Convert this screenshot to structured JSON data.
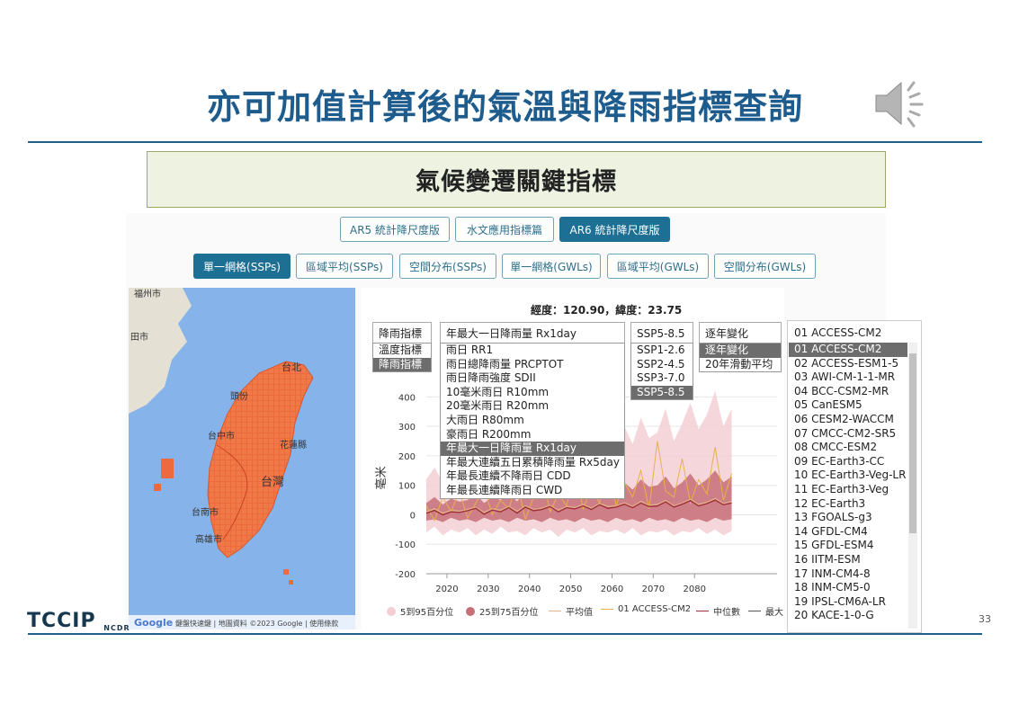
{
  "slide": {
    "title": "亦可加值計算後的氣溫與降雨指標查詢",
    "subtitle": "氣候變遷關鍵指標",
    "page_number": "33",
    "logo_text": "TCCIP",
    "logo_sub": "NCDR"
  },
  "version_tabs": [
    {
      "label": "AR5 統計降尺度版",
      "active": false
    },
    {
      "label": "水文應用指標篇",
      "active": false
    },
    {
      "label": "AR6 統計降尺度版",
      "active": true
    }
  ],
  "mode_tabs": [
    {
      "label": "單一網格(SSPs)",
      "active": true
    },
    {
      "label": "區域平均(SSPs)",
      "active": false
    },
    {
      "label": "空間分布(SSPs)",
      "active": false
    },
    {
      "label": "單一網格(GWLs)",
      "active": false
    },
    {
      "label": "區域平均(GWLs)",
      "active": false
    },
    {
      "label": "空間分布(GWLs)",
      "active": false
    }
  ],
  "map": {
    "labels": [
      "福州市",
      "田市",
      "台北",
      "頭份",
      "台中市",
      "花蓮縣",
      "台灣",
      "台南市",
      "高雄市"
    ],
    "attribution": "鍵盤快速鍵 | 地圖資料 ©2023 Google | 使用條款",
    "google": "Google"
  },
  "coords": "經度：120.90，緯度：23.75",
  "selectors": {
    "category": {
      "value": "降雨指標",
      "options": [
        {
          "label": "溫度指標",
          "selected": false
        },
        {
          "label": "降雨指標",
          "selected": true
        }
      ]
    },
    "index": {
      "value": "年最大一日降雨量 Rx1day",
      "options": [
        {
          "label": "雨日 RR1",
          "selected": false
        },
        {
          "label": "雨日總降雨量 PRCPTOT",
          "selected": false
        },
        {
          "label": "雨日降雨強度 SDII",
          "selected": false
        },
        {
          "label": "10毫米雨日 R10mm",
          "selected": false
        },
        {
          "label": "20毫米雨日 R20mm",
          "selected": false
        },
        {
          "label": "大雨日 R80mm",
          "selected": false
        },
        {
          "label": "豪雨日 R200mm",
          "selected": false
        },
        {
          "label": "年最大一日降雨量 Rx1day",
          "selected": true
        },
        {
          "label": "年最大連續五日累積降雨量 Rx5day",
          "selected": false
        },
        {
          "label": "年最長連續不降雨日 CDD",
          "selected": false
        },
        {
          "label": "年最長連續降雨日 CWD",
          "selected": false
        }
      ]
    },
    "scenario": {
      "value": "SSP5-8.5",
      "options": [
        {
          "label": "SSP1-2.6",
          "selected": false
        },
        {
          "label": "SSP2-4.5",
          "selected": false
        },
        {
          "label": "SSP3-7.0",
          "selected": false
        },
        {
          "label": "SSP5-8.5",
          "selected": true
        }
      ]
    },
    "change": {
      "value": "逐年變化",
      "options": [
        {
          "label": "逐年變化",
          "selected": true
        },
        {
          "label": "20年滑動平均",
          "selected": false
        }
      ]
    },
    "model": {
      "value": "01 ACCESS-CM2",
      "options": [
        {
          "label": "01 ACCESS-CM2",
          "selected": true
        },
        {
          "label": "02 ACCESS-ESM1-5",
          "selected": false
        },
        {
          "label": "03 AWI-CM-1-1-MR",
          "selected": false
        },
        {
          "label": "04 BCC-CSM2-MR",
          "selected": false
        },
        {
          "label": "05 CanESM5",
          "selected": false
        },
        {
          "label": "06 CESM2-WACCM",
          "selected": false
        },
        {
          "label": "07 CMCC-CM2-SR5",
          "selected": false
        },
        {
          "label": "08 CMCC-ESM2",
          "selected": false
        },
        {
          "label": "09 EC-Earth3-CC",
          "selected": false
        },
        {
          "label": "10 EC-Earth3-Veg-LR",
          "selected": false
        },
        {
          "label": "11 EC-Earth3-Veg",
          "selected": false
        },
        {
          "label": "12 EC-Earth3",
          "selected": false
        },
        {
          "label": "13 FGOALS-g3",
          "selected": false
        },
        {
          "label": "14 GFDL-CM4",
          "selected": false
        },
        {
          "label": "15 GFDL-ESM4",
          "selected": false
        },
        {
          "label": "16 IITM-ESM",
          "selected": false
        },
        {
          "label": "17 INM-CM4-8",
          "selected": false
        },
        {
          "label": "18 INM-CM5-0",
          "selected": false
        },
        {
          "label": "19 IPSL-CM6A-LR",
          "selected": false
        },
        {
          "label": "20 KACE-1-0-G",
          "selected": false
        }
      ]
    }
  },
  "chart_data": {
    "type": "line",
    "ylabel": "毫米",
    "ylim": [
      -200,
      450
    ],
    "xlim": [
      2015,
      2100
    ],
    "y_ticks": [
      400,
      300,
      200,
      100,
      0,
      -100,
      -200
    ],
    "x_ticks": [
      2020,
      2030,
      2040,
      2050,
      2060,
      2070,
      2080
    ],
    "years": [
      2015,
      2017,
      2019,
      2021,
      2023,
      2025,
      2027,
      2029,
      2031,
      2033,
      2035,
      2037,
      2039,
      2041,
      2043,
      2045,
      2047,
      2049,
      2051,
      2053,
      2055,
      2057,
      2059,
      2061,
      2063,
      2065,
      2067,
      2069,
      2071,
      2073,
      2075,
      2077,
      2079,
      2081,
      2083,
      2085,
      2087,
      2089
    ],
    "p5_95_high": [
      120,
      160,
      110,
      170,
      130,
      150,
      190,
      120,
      170,
      140,
      200,
      150,
      220,
      160,
      190,
      240,
      170,
      230,
      200,
      260,
      210,
      280,
      230,
      250,
      300,
      240,
      330,
      260,
      280,
      360,
      250,
      310,
      380,
      290,
      340,
      420,
      300,
      360
    ],
    "p5_95_low": [
      -60,
      -40,
      -70,
      -50,
      -60,
      -45,
      -70,
      -50,
      -65,
      -40,
      -60,
      -55,
      -70,
      -45,
      -60,
      -50,
      -75,
      -50,
      -60,
      -45,
      -70,
      -55,
      -60,
      -50,
      -65,
      -45,
      -70,
      -55,
      -60,
      -50,
      -70,
      -55,
      -60,
      -45,
      -65,
      -50,
      -70,
      -55
    ],
    "p25_75_high": [
      40,
      60,
      35,
      55,
      45,
      50,
      70,
      40,
      60,
      50,
      75,
      45,
      80,
      55,
      65,
      85,
      55,
      80,
      70,
      95,
      70,
      100,
      80,
      90,
      110,
      85,
      120,
      95,
      100,
      130,
      90,
      110,
      140,
      100,
      120,
      150,
      110,
      130
    ],
    "p25_75_low": [
      -20,
      -15,
      -25,
      -10,
      -20,
      -15,
      -25,
      -10,
      -20,
      -15,
      -25,
      -10,
      -20,
      -15,
      -25,
      -10,
      -20,
      -15,
      -25,
      -10,
      -20,
      -15,
      -25,
      -10,
      -20,
      -15,
      -25,
      -10,
      -20,
      -15,
      -25,
      -10,
      -20,
      -15,
      -25,
      -10,
      -20,
      -15
    ],
    "series": [
      {
        "name": "平均值",
        "values": [
          10,
          20,
          5,
          15,
          12,
          18,
          25,
          8,
          20,
          15,
          28,
          12,
          30,
          18,
          22,
          32,
          15,
          28,
          24,
          35,
          22,
          38,
          28,
          30,
          40,
          28,
          45,
          32,
          35,
          48,
          30,
          40,
          52,
          35,
          42,
          55,
          38,
          45
        ]
      },
      {
        "name": "01 ACCESS-CM2",
        "values": [
          30,
          -20,
          60,
          10,
          80,
          -10,
          40,
          90,
          0,
          50,
          20,
          110,
          -15,
          60,
          140,
          10,
          70,
          30,
          160,
          20,
          90,
          40,
          200,
          30,
          110,
          60,
          150,
          20,
          250,
          80,
          60,
          190,
          40,
          120,
          70,
          230,
          50,
          140
        ]
      },
      {
        "name": "中位數",
        "values": [
          5,
          15,
          0,
          10,
          8,
          14,
          22,
          2,
          16,
          10,
          24,
          6,
          26,
          14,
          18,
          28,
          10,
          24,
          20,
          30,
          18,
          34,
          22,
          26,
          36,
          24,
          40,
          28,
          30,
          44,
          26,
          36,
          48,
          30,
          38,
          50,
          34,
          40
        ]
      }
    ],
    "legend": [
      "5到95百分位",
      "25到75百分位",
      "平均值",
      "01 ACCESS-CM2",
      "中位數",
      "最大值"
    ],
    "legend_visible": [
      "5到95百分位",
      "25到75百分位",
      "平均值",
      "01 ACCESS-CM2",
      "中位數",
      "最大"
    ],
    "colors": {
      "p5_95": "#f3cfd3",
      "p25_75": "#c66f78",
      "mean": "#e3b28a",
      "model": "#e8b14a",
      "median": "#9e2f3c",
      "max": "#555555"
    }
  }
}
